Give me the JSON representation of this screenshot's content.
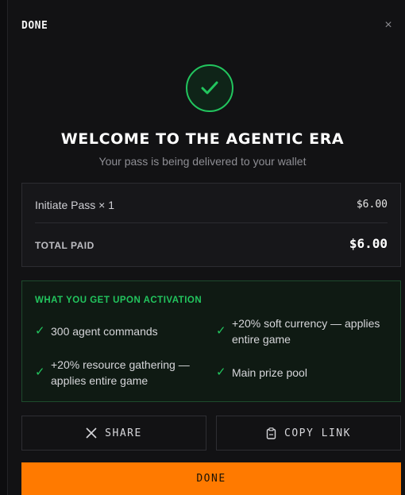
{
  "header": {
    "title": "DONE",
    "close_symbol": "×"
  },
  "success": {
    "icon": "check-icon",
    "accent_color": "#22c55e",
    "headline": "WELCOME TO THE AGENTIC ERA",
    "subline": "Your pass is being delivered to your wallet"
  },
  "order": {
    "item_label": "Initiate Pass × 1",
    "item_price": "$6.00",
    "total_label": "TOTAL PAID",
    "total_value": "$6.00"
  },
  "perks": {
    "title": "WHAT YOU GET UPON ACTIVATION",
    "tick": "✓",
    "items": [
      "300 agent commands",
      "+20% soft currency — applies entire game",
      "+20% resource gathering — applies entire game",
      "Main prize pool"
    ]
  },
  "actions": {
    "share_label": "SHARE",
    "share_icon": "x-logo-icon",
    "copy_label": "COPY LINK",
    "copy_icon": "clipboard-icon",
    "done_label": "DONE",
    "done_color": "#ff7a00"
  }
}
